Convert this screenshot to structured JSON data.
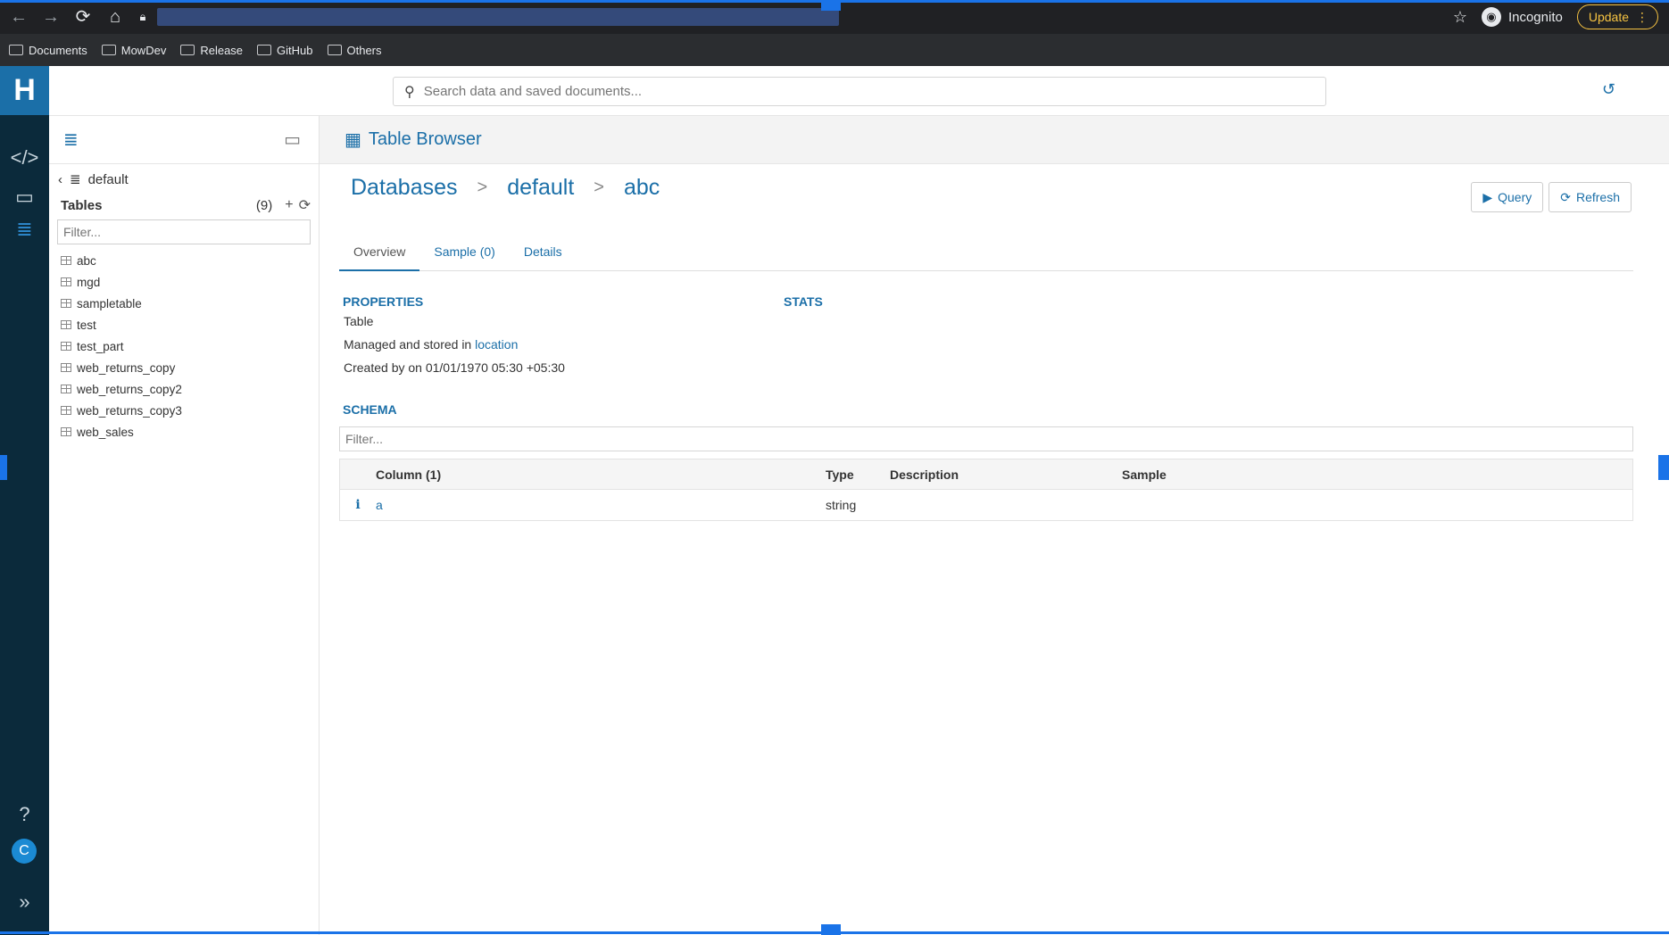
{
  "browser": {
    "bookmarks": [
      "Documents",
      "MowDev",
      "Release",
      "GitHub",
      "Others"
    ],
    "profile": "Incognito",
    "update_label": "Update"
  },
  "header": {
    "search_placeholder": "Search data and saved documents..."
  },
  "assist": {
    "database": "default",
    "tables_label": "Tables",
    "tables_count": "(9)",
    "filter_placeholder": "Filter...",
    "tables": [
      "abc",
      "mgd",
      "sampletable",
      "test",
      "test_part",
      "web_returns_copy",
      "web_returns_copy2",
      "web_returns_copy3",
      "web_sales"
    ]
  },
  "main": {
    "title": "Table Browser",
    "breadcrumb": [
      "Databases",
      "default",
      "abc"
    ],
    "query_label": "Query",
    "refresh_label": "Refresh",
    "tabs": [
      "Overview",
      "Sample (0)",
      "Details"
    ],
    "properties_heading": "PROPERTIES",
    "stats_heading": "STATS",
    "prop_type": "Table",
    "prop_managed_prefix": "Managed and stored in",
    "prop_location_link": "location",
    "prop_created": "Created by on 01/01/1970 05:30 +05:30",
    "schema_heading": "SCHEMA",
    "schema_filter_placeholder": "Filter...",
    "columns": {
      "headers": [
        "Column (1)",
        "Type",
        "Description",
        "Sample"
      ],
      "rows": [
        {
          "info": "i",
          "name": "a",
          "type": "string",
          "description": "",
          "sample": ""
        }
      ]
    }
  },
  "colors": {
    "accent": "#1b6fa8",
    "rail_bg": "#0b2a3b",
    "chrome_bg": "#202124"
  }
}
